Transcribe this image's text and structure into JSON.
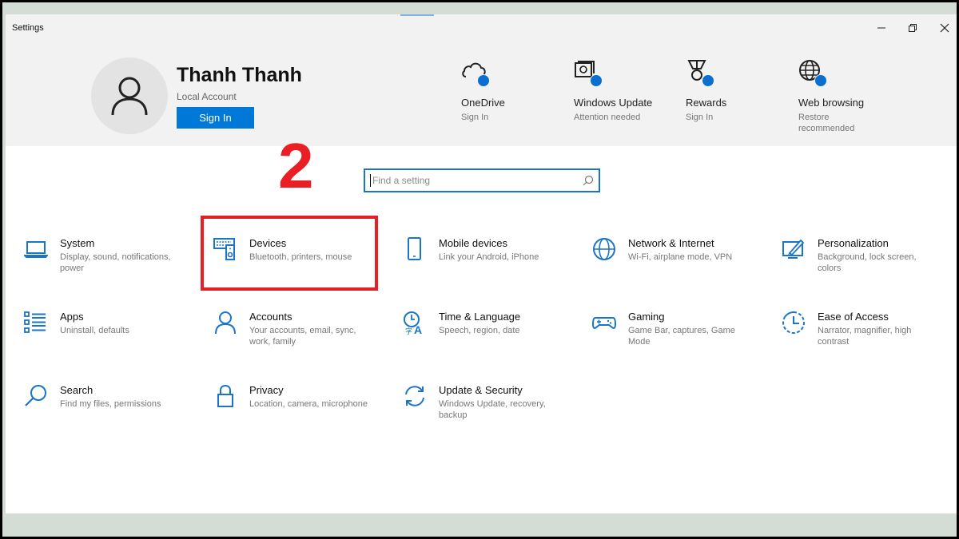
{
  "window": {
    "title": "Settings"
  },
  "account": {
    "name": "Thanh Thanh",
    "type": "Local Account",
    "sign_in_label": "Sign In"
  },
  "quick_status": [
    {
      "label": "OneDrive",
      "sub": "Sign In",
      "icon": "cloud-icon"
    },
    {
      "label": "Windows Update",
      "sub": "Attention needed",
      "icon": "windows-update-icon"
    },
    {
      "label": "Rewards",
      "sub": "Sign In",
      "icon": "rewards-medal-icon"
    },
    {
      "label": "Web browsing",
      "sub": "Restore recommended",
      "icon": "globe-icon"
    }
  ],
  "annotation": {
    "step": "2",
    "highlight_color": "#e51f26"
  },
  "search": {
    "placeholder": "Find a setting"
  },
  "categories": [
    {
      "title": "System",
      "desc": "Display, sound, notifications, power",
      "icon": "laptop-icon"
    },
    {
      "title": "Devices",
      "desc": "Bluetooth, printers, mouse",
      "icon": "keyboard-speaker-icon"
    },
    {
      "title": "Mobile devices",
      "desc": "Link your Android, iPhone",
      "icon": "phone-icon"
    },
    {
      "title": "Network & Internet",
      "desc": "Wi-Fi, airplane mode, VPN",
      "icon": "globe-icon"
    },
    {
      "title": "Personalization",
      "desc": "Background, lock screen, colors",
      "icon": "paint-brush-icon"
    },
    {
      "title": "Apps",
      "desc": "Uninstall, defaults",
      "icon": "apps-list-icon"
    },
    {
      "title": "Accounts",
      "desc": "Your accounts, email, sync, work, family",
      "icon": "person-icon"
    },
    {
      "title": "Time & Language",
      "desc": "Speech, region, date",
      "icon": "time-language-icon"
    },
    {
      "title": "Gaming",
      "desc": "Game Bar, captures, Game Mode",
      "icon": "gamepad-icon"
    },
    {
      "title": "Ease of Access",
      "desc": "Narrator, magnifier, high contrast",
      "icon": "ease-of-access-icon"
    },
    {
      "title": "Search",
      "desc": "Find my files, permissions",
      "icon": "search-icon"
    },
    {
      "title": "Privacy",
      "desc": "Location, camera, microphone",
      "icon": "lock-icon"
    },
    {
      "title": "Update & Security",
      "desc": "Windows Update, recovery, backup",
      "icon": "sync-icon"
    }
  ],
  "colors": {
    "accent": "#0078d7",
    "icon_blue": "#1a74c7",
    "status_dot": "#0a6fce"
  }
}
